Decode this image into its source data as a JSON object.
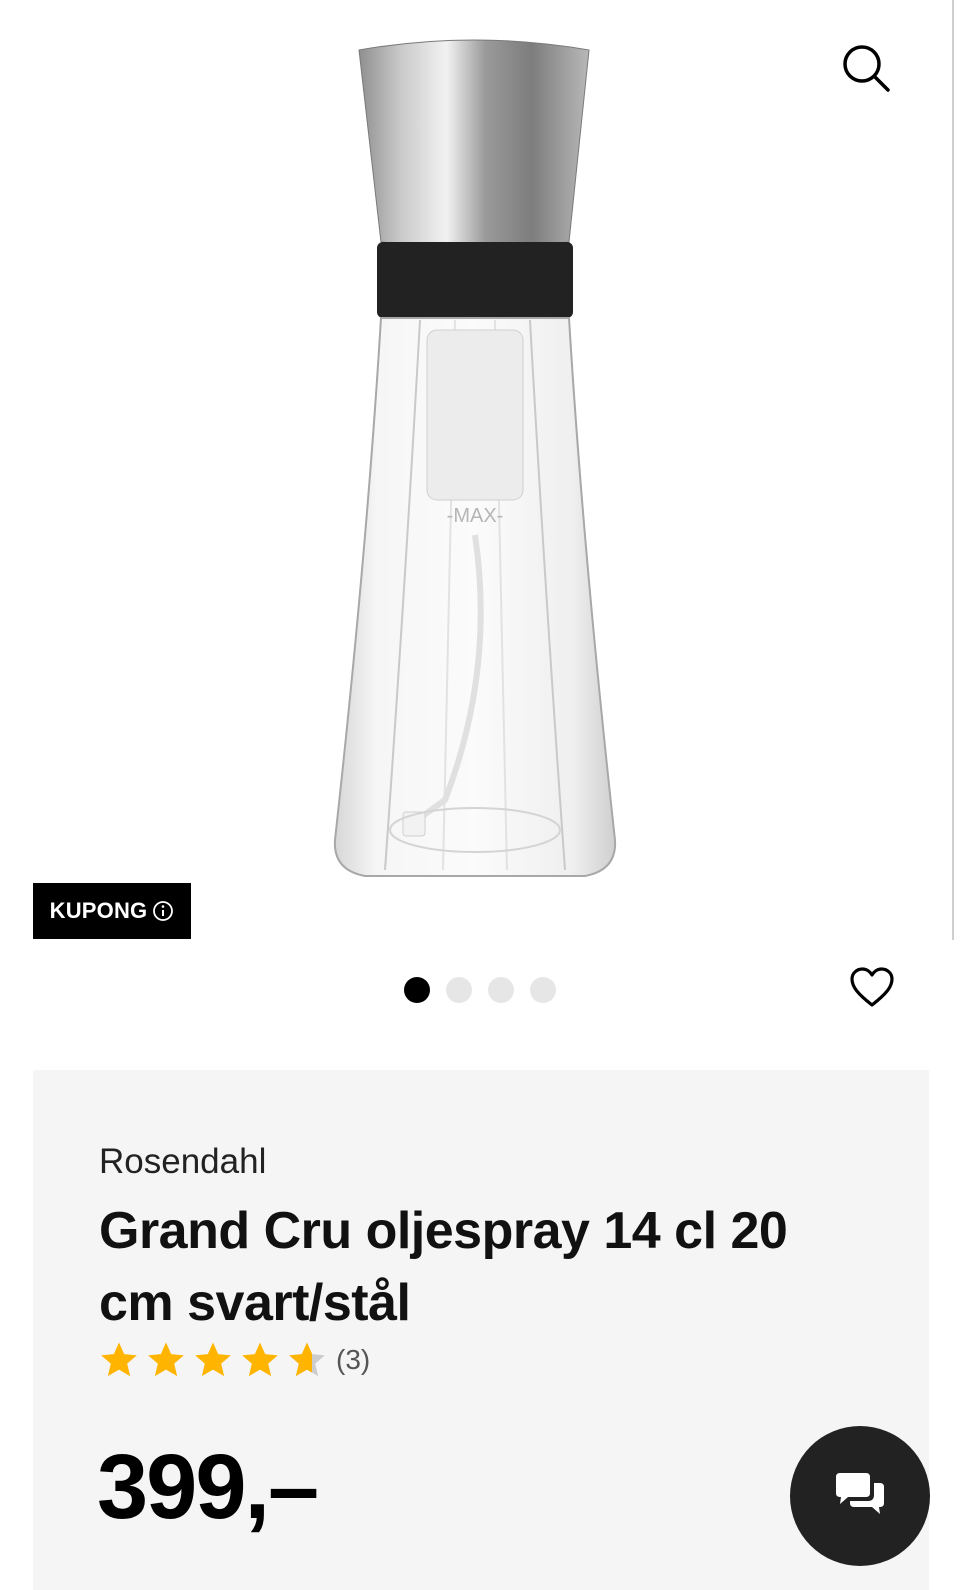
{
  "product": {
    "brand": "Rosendahl",
    "title": "Grand Cru oljespray 14 cl 20 cm svart/stål",
    "price": "399,–",
    "rating": {
      "value": 4.5,
      "max": 5,
      "count_label": "(3)"
    },
    "image_text": "-MAX-",
    "image_alt": "Grand Cru oljespray"
  },
  "gallery": {
    "coupon_label": "KUPONG",
    "active_index": 0,
    "total": 4
  },
  "icons": {
    "search": "search-icon",
    "favorite": "heart-icon",
    "info": "info-icon",
    "chat": "chat-icon",
    "star": "star-icon"
  },
  "colors": {
    "star": "#ffb400",
    "star_empty": "#cccccc",
    "badge_bg": "#000000",
    "panel_bg": "#f5f5f5",
    "chat_bg": "#222222"
  }
}
